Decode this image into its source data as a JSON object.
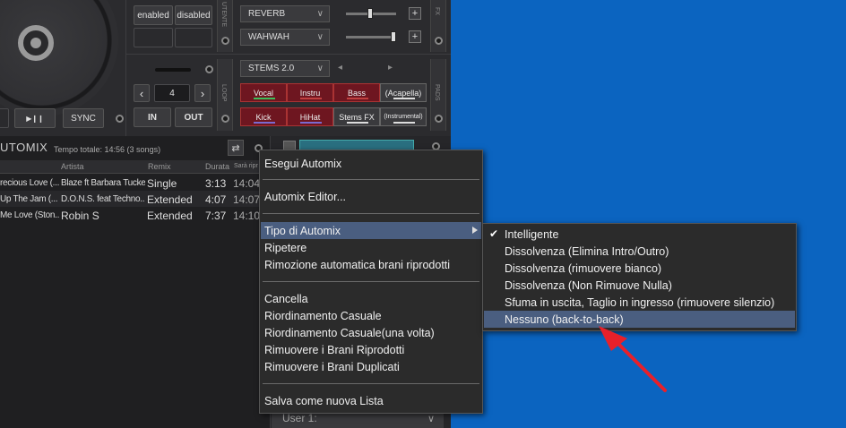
{
  "deck": {
    "fx_buttons": [
      "enabled",
      "disabled"
    ],
    "utente_label": "UTENTE",
    "fx_label": "FX",
    "loop_label": "LOOP",
    "pads_label": "PADS",
    "effects": [
      "REVERB",
      "WAHWAH"
    ],
    "stems_dropdown": "STEMS 2.0",
    "loop_value": "4",
    "play_glyph": "▶❙❙",
    "sync_label": "SYNC",
    "in_label": "IN",
    "out_label": "OUT",
    "nav_left": "‹",
    "nav_right": "›",
    "tri_left": "◂",
    "tri_right": "▸",
    "plus": "+",
    "stems": [
      {
        "label": "Vocal",
        "style": "red",
        "bar": "#3bbf5a"
      },
      {
        "label": "Instru",
        "style": "red",
        "bar": "#c04040"
      },
      {
        "label": "Bass",
        "style": "red",
        "bar": "#c04040"
      },
      {
        "label": "(Acapella)",
        "style": "grey",
        "bar": "#dddddd"
      },
      {
        "label": "Kick",
        "style": "red",
        "bar": "#7a6ad0"
      },
      {
        "label": "HiHat",
        "style": "red",
        "bar": "#7a6ad0"
      },
      {
        "label": "Stems FX",
        "style": "grey",
        "bar": "#dddddd"
      },
      {
        "label": "(Instrumental)",
        "style": "grey",
        "bar": "#dddddd"
      }
    ]
  },
  "automix": {
    "title": "UTOMIX",
    "total": "Tempo totale: 14:56 (3 songs)",
    "columns": [
      "Artista",
      "Remix",
      "Durata",
      "Sarà ripr"
    ],
    "rows": [
      {
        "title": "recious Love (...",
        "artist": "Blaze ft Barbara Tucker",
        "remix": "Single",
        "duration": "3:13",
        "time": "14:04"
      },
      {
        "title": "Up The Jam (...",
        "artist": "D.O.N.S. feat Techno...",
        "remix": "Extended",
        "duration": "4:07",
        "time": "14:07"
      },
      {
        "title": "Me Love (Ston...",
        "artist": "Robin S",
        "remix": "Extended",
        "duration": "7:37",
        "time": "14:10"
      }
    ]
  },
  "user_dropdown": "User 1:",
  "user_dropdown_chev": "∨",
  "context_menu": {
    "items": [
      "Esegui Automix",
      "Automix Editor...",
      "Tipo di Automix",
      "Ripetere",
      "Rimozione automatica brani riprodotti",
      "Cancella",
      "Riordinamento Casuale",
      "Riordinamento Casuale(una volta)",
      "Rimuovere i Brani Riprodotti",
      "Rimuovere i Brani Duplicati",
      "Salva come nuova Lista"
    ]
  },
  "submenu": {
    "items": [
      "Intelligente",
      "Dissolvenza (Elimina Intro/Outro)",
      "Dissolvenza (rimuovere bianco)",
      "Dissolvenza (Non Rimuove Nulla)",
      "Sfuma in uscita, Taglio in ingresso (rimuovere silenzio)",
      "Nessuno (back-to-back)"
    ],
    "check": "✔"
  },
  "colors": {
    "desktop": "#0b64c0",
    "highlight": "#4a5e80",
    "annotation_arrow": "#e8202a"
  }
}
